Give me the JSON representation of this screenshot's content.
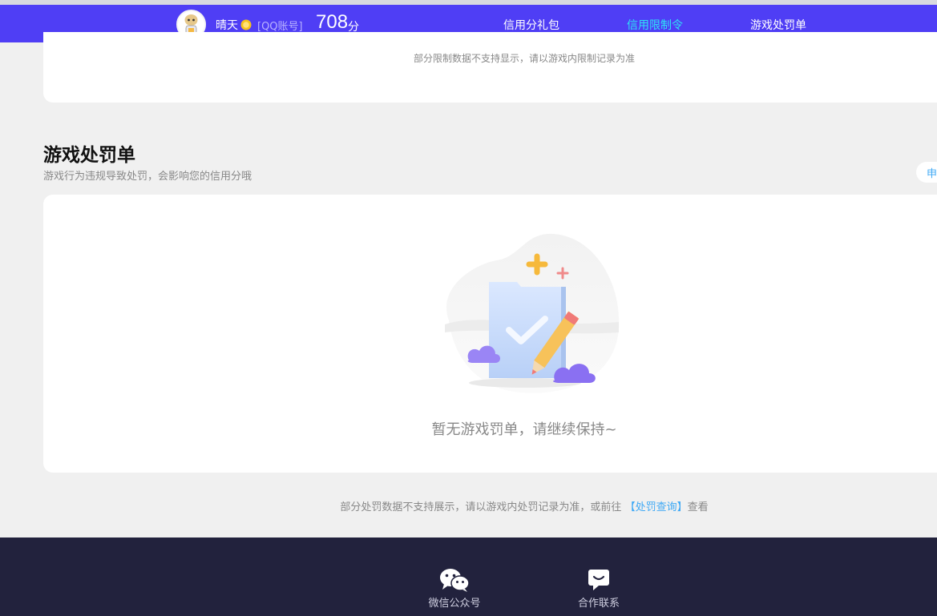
{
  "header": {
    "username": "晴天",
    "account_type": "[QQ账号]",
    "score": "708",
    "score_unit": "分",
    "nav": [
      {
        "label": "信用分礼包",
        "active": false
      },
      {
        "label": "信用限制令",
        "active": true
      },
      {
        "label": "游戏处罚单",
        "active": false
      }
    ]
  },
  "restriction_card": {
    "notice": "部分限制数据不支持显示，请以游戏内限制记录为准"
  },
  "penalty_section": {
    "title": "游戏处罚单",
    "subtitle": "游戏行为违规导致处罚，会影响您的信用分哦",
    "appeal_button": "申",
    "empty_text": "暂无游戏罚单，请继续保持~",
    "bottom_notice_prefix": "部分处罚数据不支持展示，请以游戏内处罚记录为准，或前往",
    "bottom_notice_link": "【处罚查询】",
    "bottom_notice_suffix": "查看"
  },
  "footer": {
    "items": [
      {
        "label": "微信公众号",
        "icon": "wechat-icon"
      },
      {
        "label": "合作联系",
        "icon": "chat-icon"
      }
    ]
  },
  "colors": {
    "navbar": "#4f3ef5",
    "active_nav": "#2ee3f5",
    "link": "#3fa9f5",
    "footer": "#22223d"
  }
}
